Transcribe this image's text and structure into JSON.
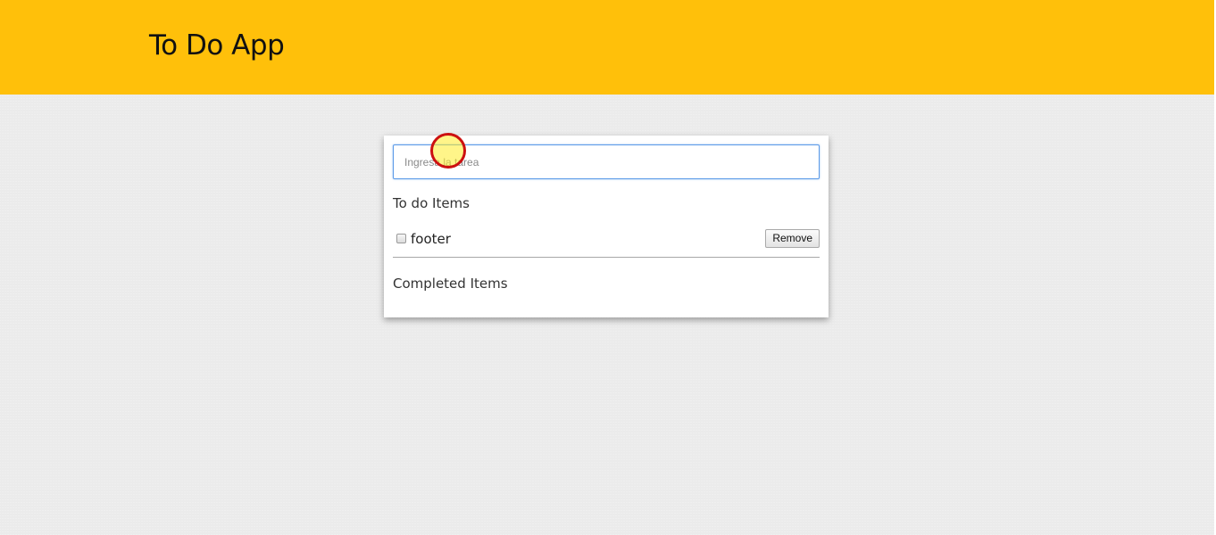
{
  "header": {
    "title": "To Do App"
  },
  "input": {
    "placeholder": "Ingresa la tarea",
    "value": ""
  },
  "todo_section": {
    "title": "To do Items",
    "items": [
      {
        "label": "footer",
        "checked": false,
        "remove_label": "Remove"
      }
    ]
  },
  "completed_section": {
    "title": "Completed Items",
    "items": []
  },
  "colors": {
    "header_bg": "#ffc00a",
    "page_bg": "#ebebeb",
    "card_bg": "#ffffff",
    "input_border": "#5b9ae8",
    "click_marker_ring": "#cc1010",
    "click_marker_fill": "#ffec28"
  }
}
